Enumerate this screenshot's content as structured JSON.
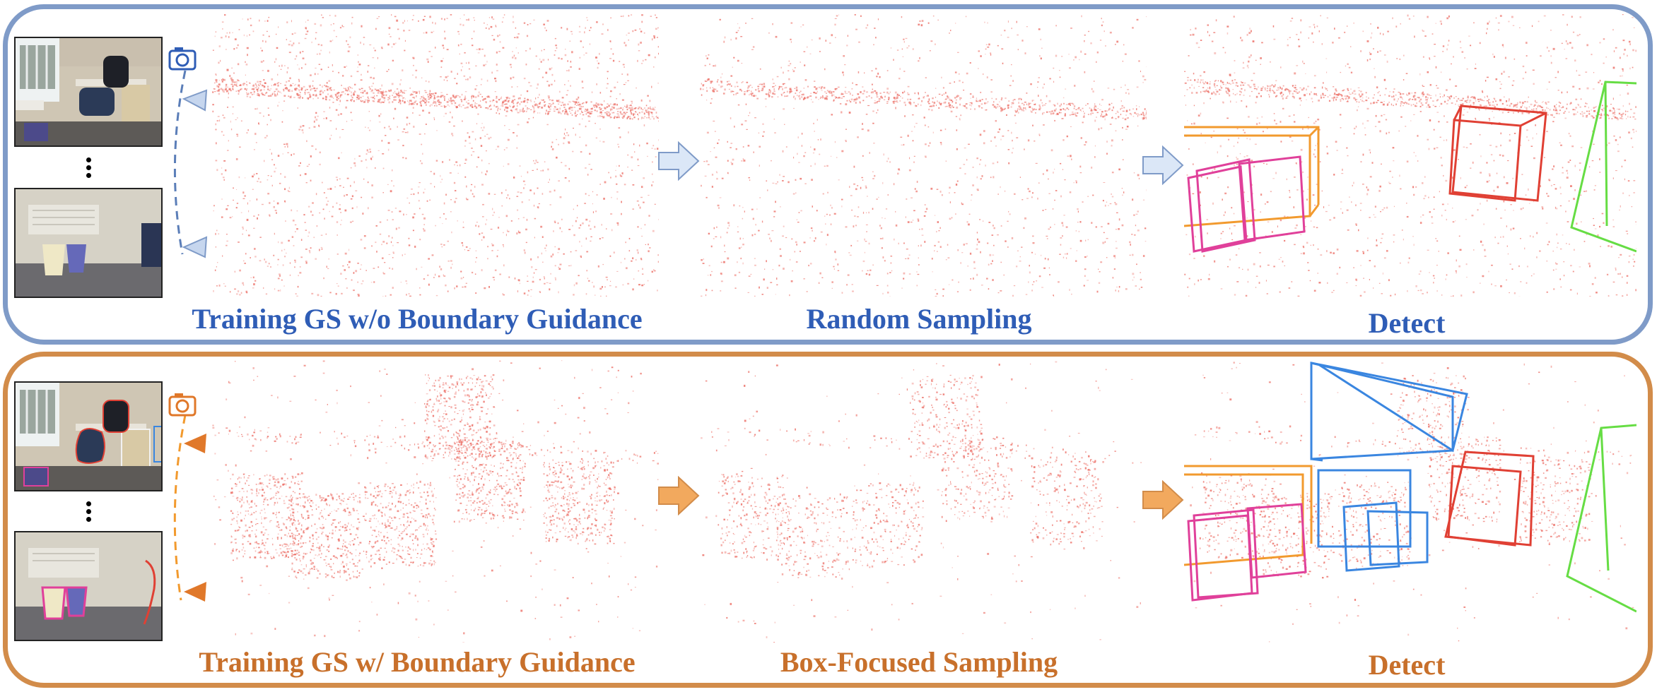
{
  "top_row": {
    "labels": [
      "Training GS w/o Boundary Guidance",
      "Random Sampling",
      "Detect"
    ],
    "accent": "#7f9bc8",
    "text_color": "#2f5db6"
  },
  "bottom_row": {
    "labels": [
      "Training GS w/ Boundary Guidance",
      "Box-Focused Sampling",
      "Detect"
    ],
    "accent": "#d28c4a",
    "text_color": "#c8702b"
  },
  "icons": [
    "camera-icon",
    "camera-frustum-icon",
    "arrow-right-icon",
    "ellipsis-dots"
  ],
  "colors": {
    "point_cloud": "#ec6f66",
    "box_orange": "#f29a2e",
    "box_magenta": "#e0409a",
    "box_red": "#e04034",
    "box_green": "#66dd44",
    "box_blue": "#3a86e0",
    "arrow_blue_fill": "#dbe7f7",
    "arrow_orange_fill": "#f2a95e"
  }
}
